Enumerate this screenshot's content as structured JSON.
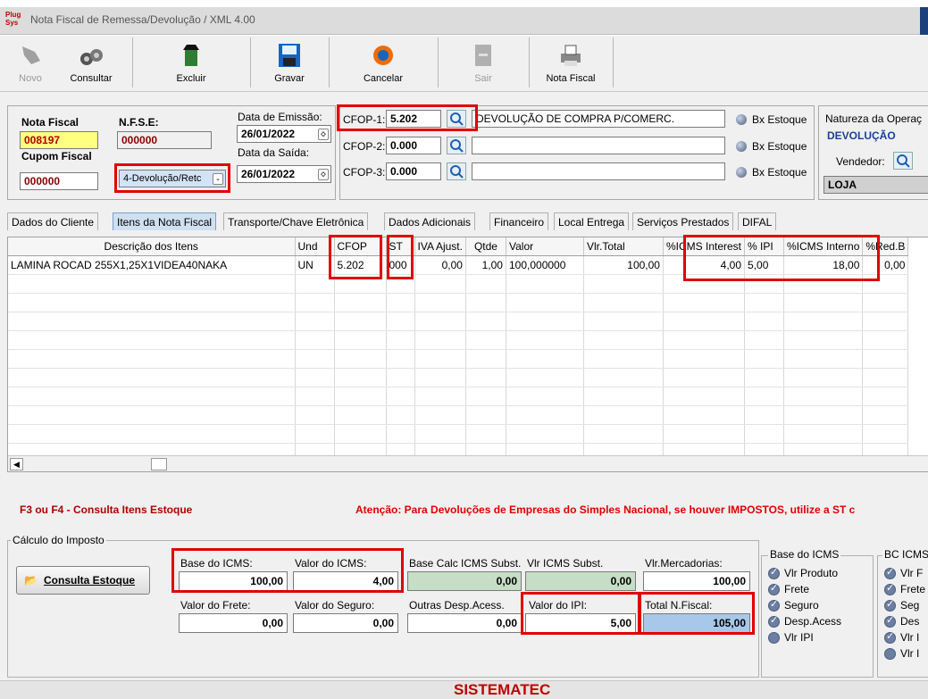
{
  "window": {
    "title": "Nota Fiscal de Remessa/Devolução / XML 4.00",
    "logo": "Plug Sys"
  },
  "toolbar": [
    {
      "label": "Novo",
      "icon": "hand-icon",
      "enabled": false
    },
    {
      "label": "Consultar",
      "icon": "binoculars-icon",
      "enabled": true
    },
    {
      "label": "Excluir",
      "icon": "trash-icon",
      "enabled": true
    },
    {
      "label": "Gravar",
      "icon": "floppy-icon",
      "enabled": true
    },
    {
      "label": "Cancelar",
      "icon": "cancel-icon",
      "enabled": true
    },
    {
      "label": "Sair",
      "icon": "exit-icon",
      "enabled": false
    },
    {
      "label": "Nota Fiscal",
      "icon": "printer-icon",
      "enabled": true
    }
  ],
  "header": {
    "nota_fiscal_label": "Nota Fiscal",
    "nota_fiscal_value": "008197",
    "nfse_label": "N.F.S.E:",
    "nfse_value": "000000",
    "cupom_label": "Cupom Fiscal",
    "cupom_value": "000000",
    "tipo_value": "4-Devolução/Retc",
    "emissao_label": "Data de Emissão:",
    "emissao_value": "26/01/2022",
    "saida_label": "Data da Saída:",
    "saida_value": "26/01/2022",
    "cfop1_label": "CFOP-1:",
    "cfop1_value": "5.202",
    "cfop1_desc": "DEVOLUÇÃO DE COMPRA P/COMERC.",
    "cfop2_label": "CFOP-2:",
    "cfop2_value": "0.000",
    "cfop2_desc": "",
    "cfop3_label": "CFOP-3:",
    "cfop3_value": "0.000",
    "cfop3_desc": "",
    "bx_estoque": "Bx Estoque",
    "natureza_label": "Natureza da Operaç",
    "natureza_value": "DEVOLUÇÃO",
    "vendedor_label": "Vendedor:",
    "vendedor_value": "LOJA"
  },
  "tabs": [
    "Dados do Cliente",
    "Itens da Nota Fiscal",
    "Transporte/Chave Eletrônica",
    "Dados Adicionais",
    "Financeiro",
    "Local Entrega",
    "Serviços Prestados",
    "DIFAL"
  ],
  "grid": {
    "columns": [
      "Descrição dos Itens",
      "Und",
      "CFOP",
      "ST",
      "IVA Ajust.",
      "Qtde",
      "Valor",
      "Vlr.Total",
      "%ICMS Interest",
      "% IPI",
      "%ICMS Interno",
      "%Red.B"
    ],
    "rows": [
      [
        "LAMINA ROCAD 255X1,25X1VIDEA40NAKA",
        "UN",
        "5.202",
        "000",
        "0,00",
        "1,00",
        "100,000000",
        "100,00",
        "4,00",
        "5,00",
        "18,00",
        "0,00"
      ]
    ]
  },
  "hints": {
    "left": "F3 ou F4 - Consulta Itens Estoque",
    "right": "Atenção: Para Devoluções de Empresas do Simples Nacional, se houver IMPOSTOS, utilize a ST c"
  },
  "calc": {
    "group_label": "Cálculo do Imposto",
    "consulta_button": "Consulta Estoque",
    "base_icms_label": "Base do ICMS:",
    "base_icms_value": "100,00",
    "valor_icms_label": "Valor do ICMS:",
    "valor_icms_value": "4,00",
    "base_subst_label": "Base Calc ICMS Subst.",
    "base_subst_value": "0,00",
    "vlr_subst_label": "Vlr ICMS Subst.",
    "vlr_subst_value": "0,00",
    "vlr_merc_label": "Vlr.Mercadorias:",
    "vlr_merc_value": "100,00",
    "frete_label": "Valor do Frete:",
    "frete_value": "0,00",
    "seguro_label": "Valor do Seguro:",
    "seguro_value": "0,00",
    "outras_label": "Outras Desp.Acess.",
    "outras_value": "0,00",
    "ipi_label": "Valor do IPI:",
    "ipi_value": "5,00",
    "total_label": "Total N.Fiscal:",
    "total_value": "105,00"
  },
  "base_icms_group": {
    "title": "Base do ICMS",
    "items": [
      "Vlr Produto",
      "Frete",
      "Seguro",
      "Desp.Acess",
      "Vlr IPI"
    ]
  },
  "bc_icms_group": {
    "title": "BC ICMS",
    "items": [
      "Vlr F",
      "Frete",
      "Seg",
      "Des",
      "Vlr I",
      "Vlr I"
    ]
  },
  "footer": {
    "brand": "SISTEMATEC"
  },
  "colors": {
    "highlight_red": "#e00000",
    "yellow_field": "#ffff80",
    "title_blue": "#1d3f7a"
  }
}
